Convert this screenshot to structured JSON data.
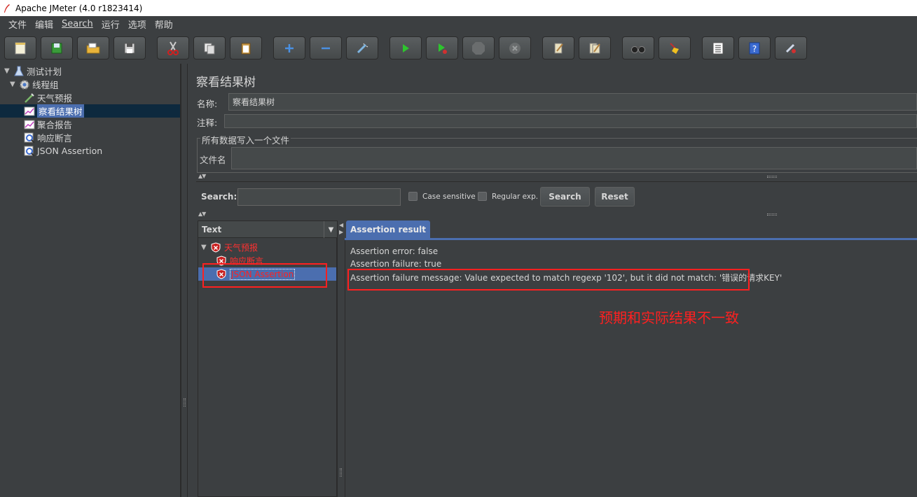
{
  "window": {
    "title": "Apache JMeter (4.0 r1823414)"
  },
  "menu": [
    "文件",
    "编辑",
    "Search",
    "运行",
    "选项",
    "帮助"
  ],
  "toolbar": {
    "buttons": [
      "new-icon",
      "templates-icon",
      "open-icon",
      "save-icon",
      "cut-icon",
      "copy-icon",
      "paste-icon",
      "expand-icon",
      "collapse-icon",
      "toggle-icon",
      "start-icon",
      "start-no-pause-icon",
      "stop-icon",
      "shutdown-icon",
      "clear-icon",
      "clear-all-icon",
      "search-icon",
      "reset-search-icon",
      "function-helper-icon",
      "help-icon",
      "remote-icon"
    ]
  },
  "tree": {
    "items": [
      {
        "label": "测试计划",
        "level": 0
      },
      {
        "label": "线程组",
        "level": 1
      },
      {
        "label": "天气预报",
        "level": 2
      },
      {
        "label": "察看结果树",
        "level": 2,
        "selected": true
      },
      {
        "label": "聚合报告",
        "level": 2
      },
      {
        "label": "响应断言",
        "level": 2
      },
      {
        "label": "JSON Assertion",
        "level": 2
      }
    ]
  },
  "panel": {
    "title": "察看结果树",
    "name_label": "名称:",
    "name_value": "察看结果树",
    "comment_label": "注释:",
    "comment_value": "",
    "file_group_label": "所有数据写入一个文件",
    "filename_label": "文件名",
    "filename_value": ""
  },
  "search": {
    "label": "Search:",
    "value": "",
    "case_sensitive_label": "Case sensitive",
    "case_sensitive_checked": false,
    "regex_label": "Regular exp.",
    "regex_checked": false,
    "search_button": "Search",
    "reset_button": "Reset"
  },
  "results": {
    "renderer": "Text",
    "tree": [
      {
        "label": "天气预报",
        "status": "failed"
      },
      {
        "label": "响应断言",
        "status": "failed"
      },
      {
        "label": "JSON Assertion",
        "status": "failed",
        "selected": true
      }
    ],
    "tab_label": "Assertion result",
    "lines": [
      "Assertion error: false",
      "Assertion failure: true",
      "Assertion failure message: Value expected to match regexp '102', but it did not match: '错误的请求KEY'"
    ]
  },
  "annotation": {
    "text": "预期和实际结果不一致",
    "color": "#ff2020"
  },
  "colors": {
    "background": "#3c3f41",
    "selection": "#4b6eaf",
    "error": "#ff2020"
  }
}
